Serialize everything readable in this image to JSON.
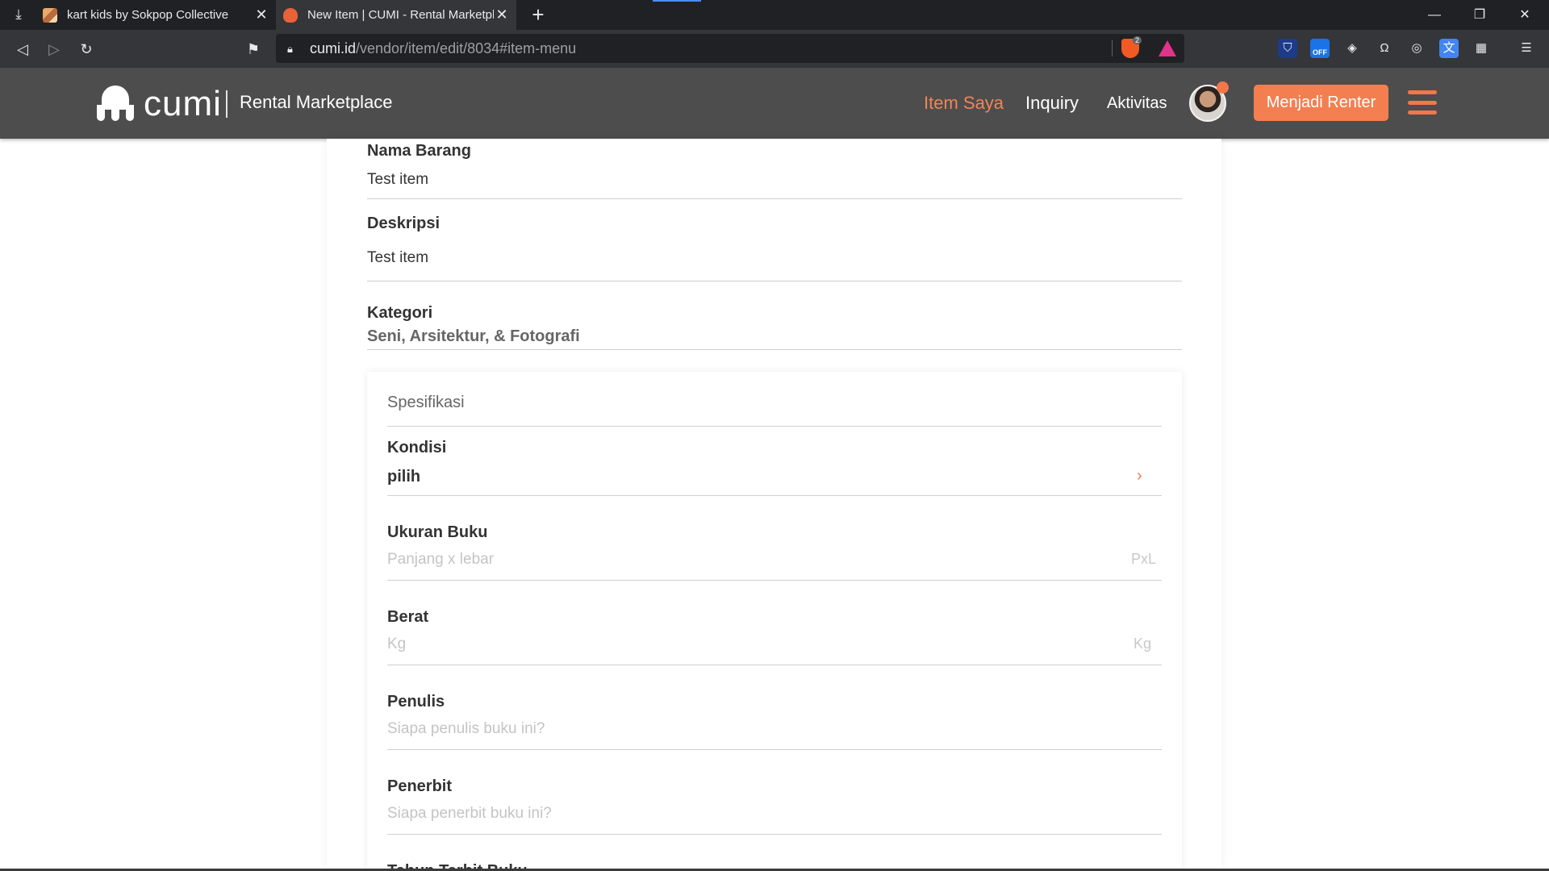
{
  "browser": {
    "tabs": [
      {
        "title": "kart kids by Sokpop Collective",
        "active": false
      },
      {
        "title": "New Item | CUMI - Rental Marketplace",
        "active": true
      }
    ],
    "url_host": "cumi.id",
    "url_path": "/vendor/item/edit/8034#item-menu",
    "brave_shield_count": "2",
    "ext_off_label": "OFF"
  },
  "header": {
    "logo_text": "cumi",
    "tagline": "Rental Marketplace",
    "nav": {
      "item_saya": "Item Saya",
      "inquiry": "Inquiry",
      "aktivitas": "Aktivitas"
    },
    "cta_label": "Menjadi Renter",
    "accent_color": "#f37748"
  },
  "form": {
    "nama_barang": {
      "label": "Nama Barang",
      "value": "Test item"
    },
    "deskripsi": {
      "label": "Deskripsi",
      "value": "Test item"
    },
    "kategori": {
      "label": "Kategori",
      "value": "Seni, Arsitektur, & Fotografi"
    }
  },
  "spesifikasi": {
    "title": "Spesifikasi",
    "kondisi": {
      "label": "Kondisi",
      "value": "pilih"
    },
    "ukuran_buku": {
      "label": "Ukuran Buku",
      "placeholder": "Panjang x lebar",
      "unit": "PxL"
    },
    "berat": {
      "label": "Berat",
      "placeholder": "Kg",
      "unit": "Kg"
    },
    "penulis": {
      "label": "Penulis",
      "placeholder": "Siapa penulis buku ini?"
    },
    "penerbit": {
      "label": "Penerbit",
      "placeholder": "Siapa penerbit buku ini?"
    },
    "next_label": "Tahun Terbit Buku"
  }
}
